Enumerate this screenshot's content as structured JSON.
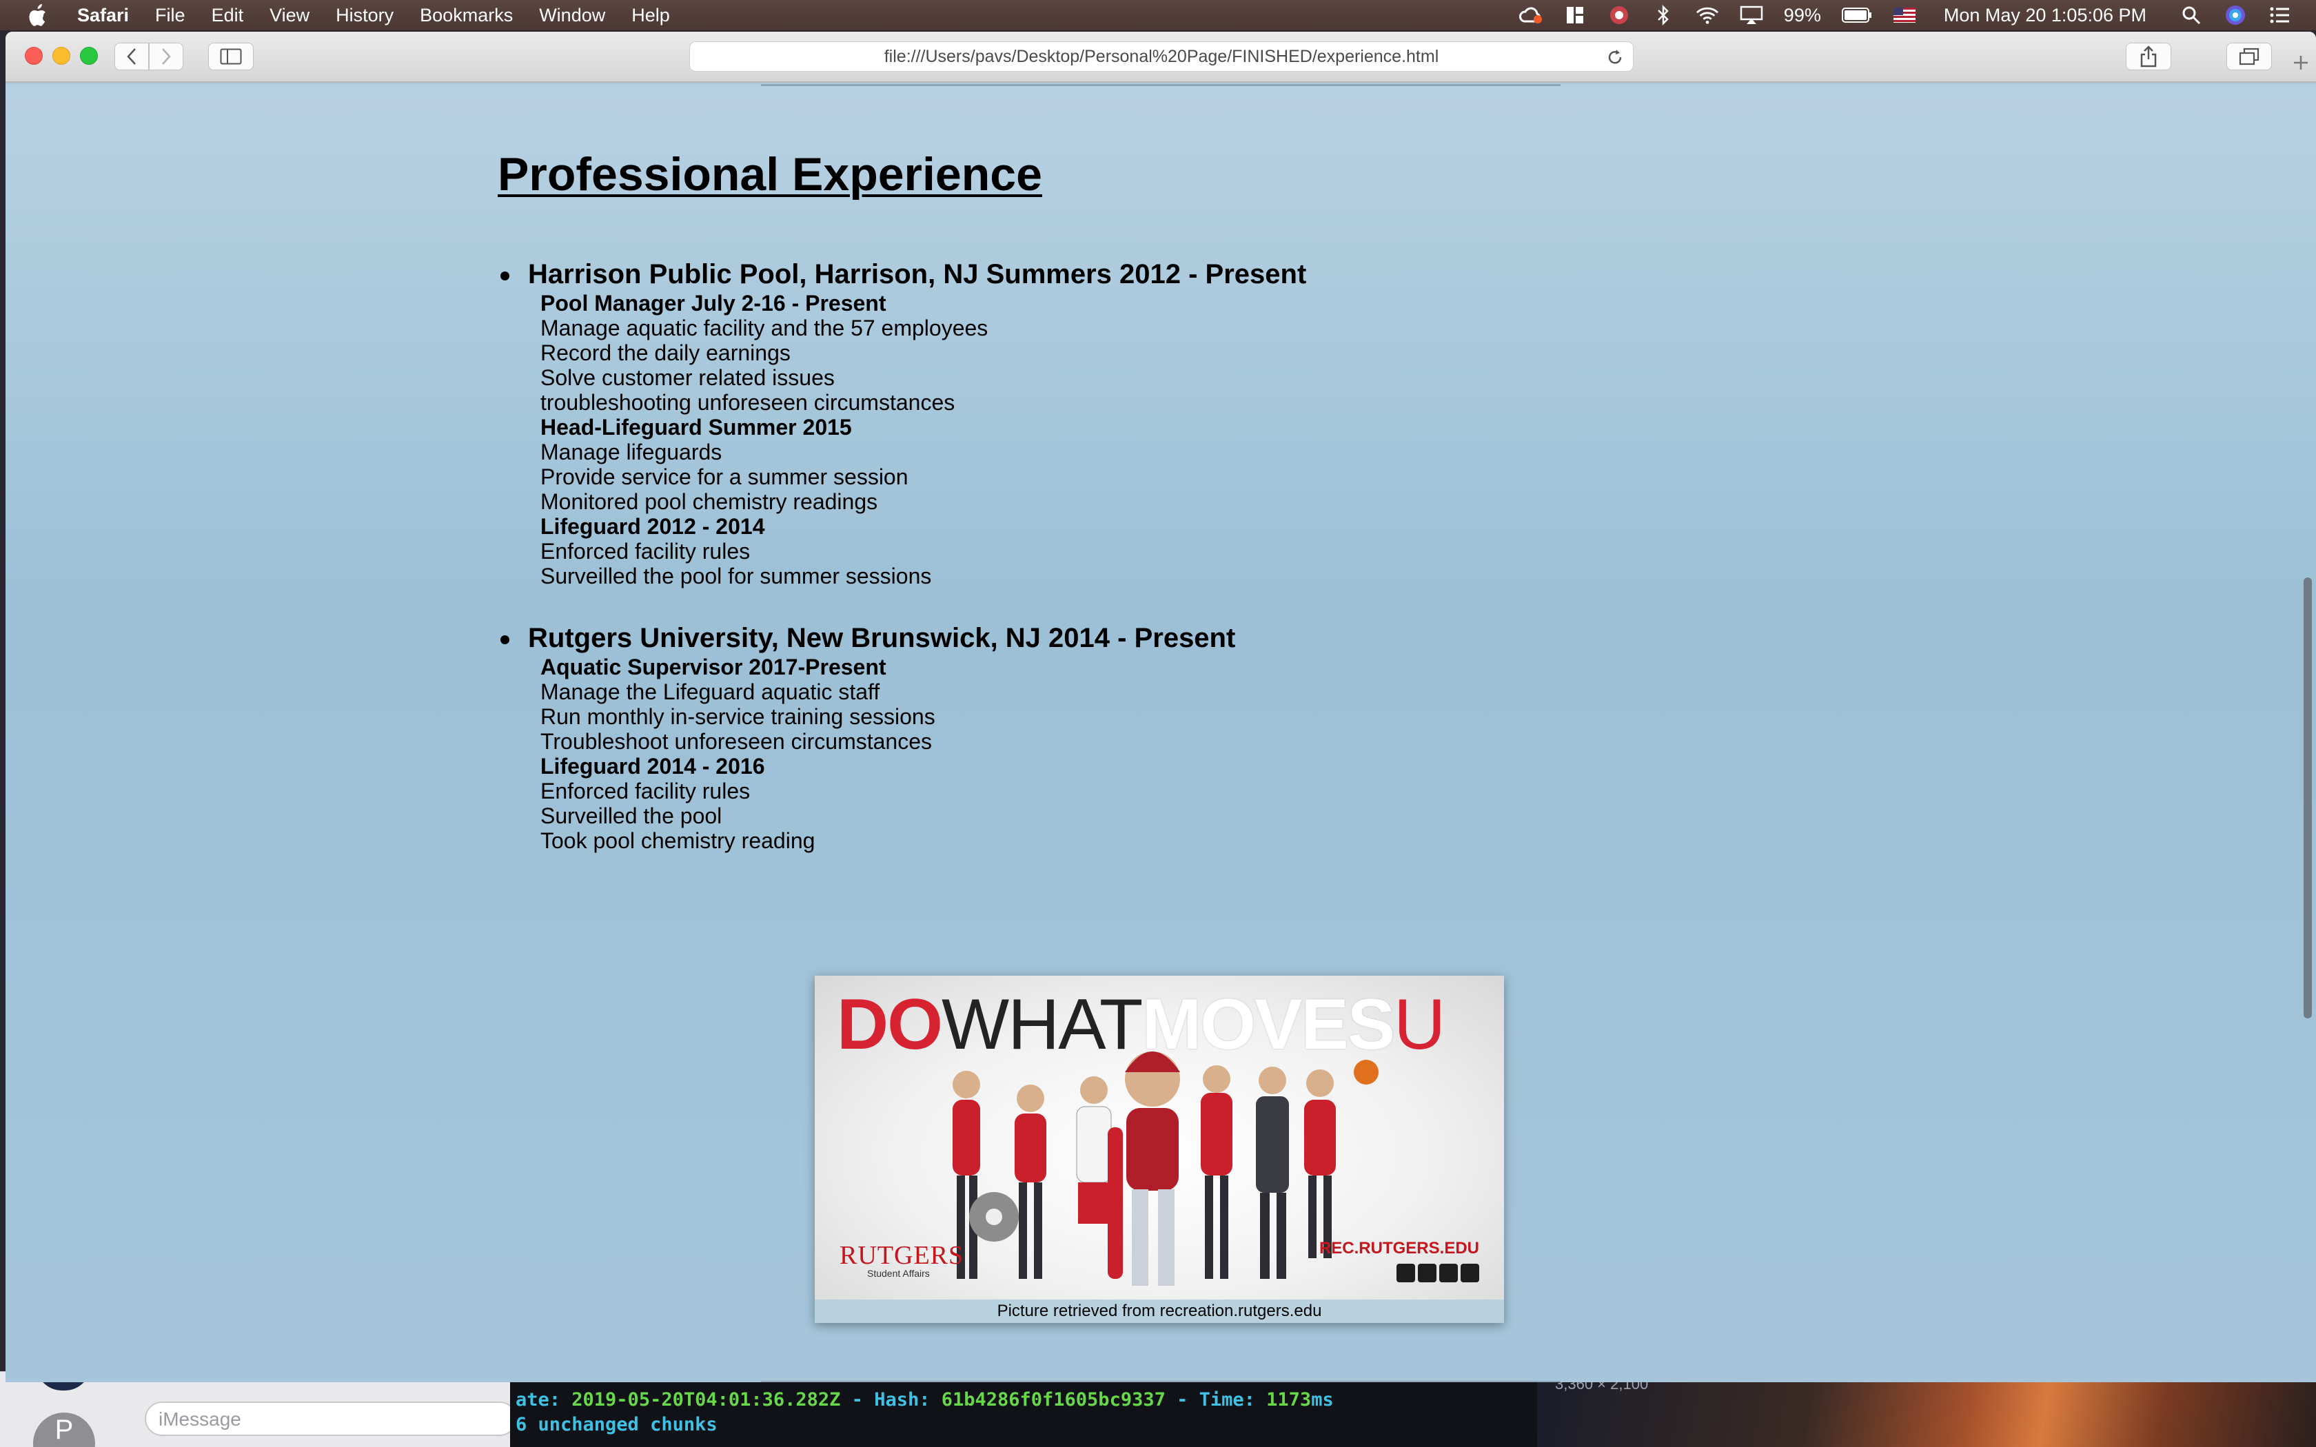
{
  "menubar": {
    "app_name": "Safari",
    "items": [
      "File",
      "Edit",
      "View",
      "History",
      "Bookmarks",
      "Window",
      "Help"
    ],
    "battery_percent": "99%",
    "datetime": "Mon May 20  1:05:06 PM"
  },
  "browser": {
    "url": "file:///Users/pavs/Desktop/Personal%20Page/FINISHED/experience.html"
  },
  "page": {
    "heading": "Professional Experience",
    "jobs": [
      {
        "title": "Harrison Public Pool, Harrison, NJ Summers 2012 - Present",
        "lines": [
          {
            "text": "Pool Manager July 2-16 - Present",
            "role": true
          },
          {
            "text": "Manage aquatic facility and the 57 employees",
            "role": false
          },
          {
            "text": "Record the daily earnings",
            "role": false
          },
          {
            "text": "Solve customer related issues",
            "role": false
          },
          {
            "text": "troubleshooting unforeseen circumstances",
            "role": false
          },
          {
            "text": "Head-Lifeguard Summer 2015",
            "role": true
          },
          {
            "text": "Manage lifeguards",
            "role": false
          },
          {
            "text": "Provide service for a summer session",
            "role": false
          },
          {
            "text": "Monitored pool chemistry readings",
            "role": false
          },
          {
            "text": "Lifeguard 2012 - 2014",
            "role": true
          },
          {
            "text": "Enforced facility rules",
            "role": false
          },
          {
            "text": "Surveilled the pool for summer sessions",
            "role": false
          }
        ]
      },
      {
        "title": "Rutgers University, New Brunswick, NJ 2014 - Present",
        "lines": [
          {
            "text": "Aquatic Supervisor 2017-Present",
            "role": true
          },
          {
            "text": "Manage the Lifeguard aquatic staff",
            "role": false
          },
          {
            "text": "Run monthly in-service training sessions",
            "role": false
          },
          {
            "text": "Troubleshoot unforeseen circumstances",
            "role": false
          },
          {
            "text": "Lifeguard 2014 - 2016",
            "role": true
          },
          {
            "text": "Enforced facility rules",
            "role": false
          },
          {
            "text": "Surveilled the pool",
            "role": false
          },
          {
            "text": "Took pool chemistry reading",
            "role": false
          }
        ]
      }
    ],
    "picture": {
      "slogan_do": "DO",
      "slogan_what": "WHAT",
      "slogan_moves": "MOVES",
      "slogan_u": "U",
      "brand_left": "RUTGERS",
      "brand_left_sub": "Student Affairs",
      "brand_right": "REC.RUTGERS.EDU",
      "caption": "Picture retrieved from recreation.rutgers.edu"
    }
  },
  "background": {
    "imessage_placeholder": "iMessage",
    "imessage_avatar_letter": "P",
    "terminal_line1_prefix": "ate: ",
    "terminal_line1_date": "2019-05-20T04:01:36.282Z",
    "terminal_line1_mid": " - Hash: ",
    "terminal_line1_hash": "61b4286f0f1605bc9337",
    "terminal_line1_time_label": " - Time: ",
    "terminal_line1_time": "1173",
    "terminal_line1_unit": "ms",
    "terminal_line2": "6 unchanged chunks",
    "wallpaper_dims": "3,360 × 2,100"
  },
  "colors": {
    "page_bg": "#a6c5da",
    "rutgers_red": "#d72231",
    "close": "#fc5f57",
    "minimize": "#fdbc2e",
    "maximize": "#28c83f"
  }
}
